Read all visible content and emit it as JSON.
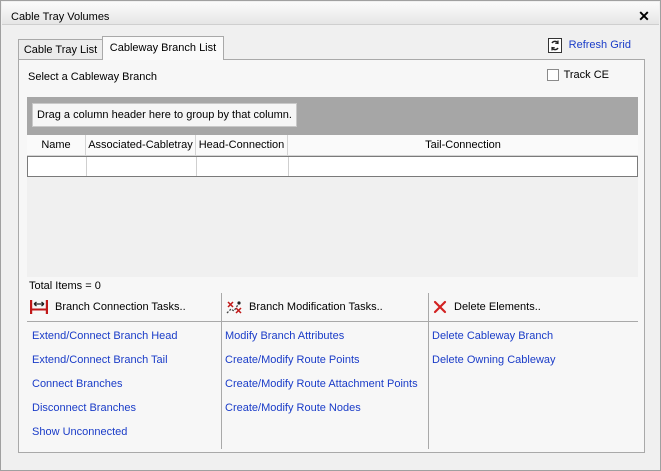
{
  "window": {
    "title": "Cable Tray Volumes"
  },
  "tabs": [
    {
      "label": "Cable Tray List"
    },
    {
      "label": "Cableway Branch List"
    }
  ],
  "toolbar": {
    "refresh_label": "Refresh Grid"
  },
  "panel": {
    "select_label": "Select a Cableway Branch",
    "track_label": "Track CE",
    "track_checked": false
  },
  "grid": {
    "group_hint": "Drag a column header here to group by that column.",
    "columns": [
      "Name",
      "Associated-Cabletray",
      "Head-Connection",
      "Tail-Connection"
    ],
    "total_items": "Total Items = 0"
  },
  "tasks": {
    "branch_connection": {
      "heading": "Branch Connection Tasks..",
      "icon": "branch-connection-icon",
      "links": [
        "Extend/Connect Branch Head",
        "Extend/Connect Branch Tail",
        "Connect Branches",
        "Disconnect Branches",
        "Show Unconnected"
      ]
    },
    "branch_modification": {
      "heading": "Branch Modification Tasks..",
      "icon": "branch-modification-icon",
      "links": [
        "Modify Branch Attributes",
        "Create/Modify Route Points",
        "Create/Modify Route Attachment Points",
        "Create/Modify Route Nodes"
      ]
    },
    "delete_elements": {
      "heading": "Delete Elements..",
      "icon": "delete-icon",
      "links": [
        "Delete Cableway Branch",
        "Delete Owning Cableway"
      ]
    }
  },
  "colors": {
    "link": "#1a3cc8",
    "group_bar": "#a6a6a6",
    "delete": "#d22222"
  }
}
